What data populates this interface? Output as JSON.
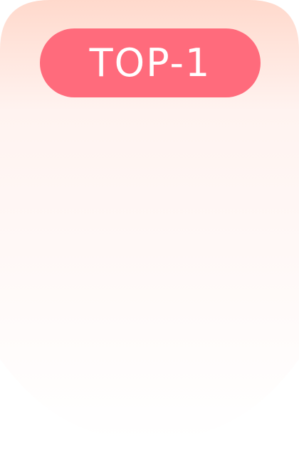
{
  "badge": {
    "label": "TOP-1"
  },
  "colors": {
    "badge_background": "#ff6b7c",
    "badge_text": "#ffffff",
    "card_gradient_top": "#ffd9cc",
    "card_gradient_mid": "#fff3f0",
    "card_gradient_bottom": "#ffffff"
  }
}
